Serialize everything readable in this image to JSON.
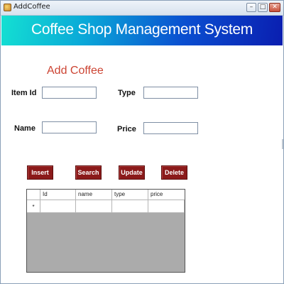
{
  "window": {
    "title": "AddCoffee",
    "minimize_glyph": "–",
    "maximize_glyph": "□",
    "close_glyph": "✕"
  },
  "banner": {
    "title": "Coffee Shop Management System"
  },
  "form": {
    "section_title": "Add Coffee",
    "item_id_label": "Item Id",
    "type_label": "Type",
    "name_label": "Name",
    "price_label": "Price",
    "item_id_value": "",
    "type_value": "",
    "name_value": "",
    "price_value": ""
  },
  "actions": {
    "insert": "Insert",
    "search": "Search",
    "update": "Update",
    "delete": "Delete"
  },
  "grid": {
    "columns": [
      "Id",
      "name",
      "type",
      "price"
    ],
    "new_row_marker": "*",
    "rows": []
  },
  "colors": {
    "banner_start": "#14e0d2",
    "banner_end": "#0a1eb0",
    "section_title": "#cc4433",
    "button_bg": "#8b1a1a",
    "grid_bg": "#ababab"
  }
}
